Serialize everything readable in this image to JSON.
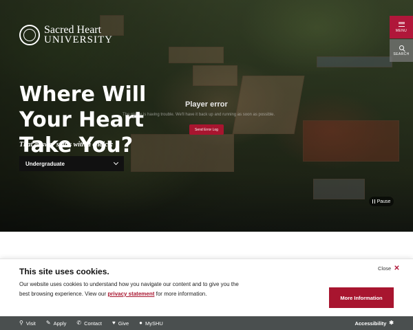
{
  "logo": {
    "line1": "Sacred Heart",
    "line2": "UNIVERSITY"
  },
  "menu": {
    "label": "MENU",
    "icon": "hamburger-icon"
  },
  "search": {
    "label": "SEARCH",
    "icon": "search-icon"
  },
  "hero": {
    "headline": "Where Will Your Heart Take You?",
    "subline": "That answer starts with a choice:",
    "select_value": "Undergraduate"
  },
  "player": {
    "error_title": "Player error",
    "error_message": "The player is having trouble. We'll have it back up and running as soon as possible.",
    "send_log_label": "Send Error Log",
    "pause_label": "Pause"
  },
  "cookie": {
    "title": "This site uses cookies.",
    "text_before": "Our website uses cookies to understand how you navigate our content and to give you the best browsing experience. View our ",
    "link_text": "privacy statement",
    "text_after": " for more information.",
    "close_label": "Close",
    "more_info_label": "More Information"
  },
  "bottom_bar": {
    "items": [
      {
        "label": "Visit",
        "icon": "map-pin-icon"
      },
      {
        "label": "Apply",
        "icon": "pencil-icon"
      },
      {
        "label": "Contact",
        "icon": "phone-icon"
      },
      {
        "label": "Give",
        "icon": "heart-icon"
      },
      {
        "label": "MySHU",
        "icon": "user-icon"
      }
    ],
    "accessibility_label": "Accessibility"
  },
  "colors": {
    "brand_red": "#a8152f",
    "menu_red": "#b0173a",
    "bottom_bar": "#4a4f4f"
  }
}
